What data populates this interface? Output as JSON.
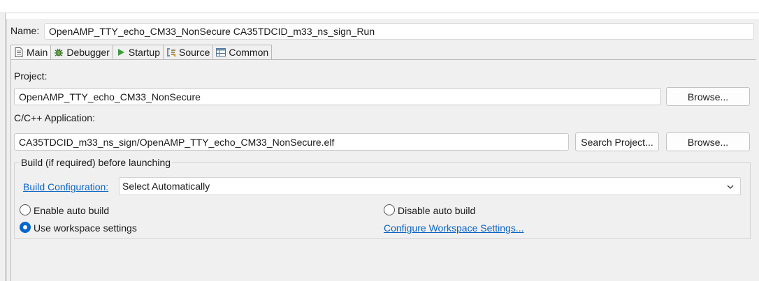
{
  "name_row": {
    "label": "Name:",
    "value": "OpenAMP_TTY_echo_CM33_NonSecure CA35TDCID_m33_ns_sign_Run"
  },
  "tabs": [
    {
      "label": "Main",
      "icon": "document-icon",
      "active": true
    },
    {
      "label": "Debugger",
      "icon": "bug-icon",
      "active": false
    },
    {
      "label": "Startup",
      "icon": "play-icon",
      "active": false
    },
    {
      "label": "Source",
      "icon": "source-lookup-icon",
      "active": false
    },
    {
      "label": "Common",
      "icon": "table-icon",
      "active": false
    }
  ],
  "project": {
    "label": "Project:",
    "value": "OpenAMP_TTY_echo_CM33_NonSecure",
    "browse_label": "Browse..."
  },
  "application": {
    "label": "C/C++ Application:",
    "value": "CA35TDCID_m33_ns_sign/OpenAMP_TTY_echo_CM33_NonSecure.elf",
    "search_label": "Search Project...",
    "browse_label": "Browse..."
  },
  "build": {
    "group_title": "Build (if required) before launching",
    "config_link": "Build Configuration:",
    "config_value": "Select Automatically",
    "options": {
      "enable_auto": {
        "label": "Enable auto build",
        "selected": false
      },
      "disable_auto": {
        "label": "Disable auto build",
        "selected": false
      },
      "use_workspace": {
        "label": "Use workspace settings",
        "selected": true
      }
    },
    "configure_link": "Configure Workspace Settings..."
  },
  "colors": {
    "panel_bg": "#f0f0f0",
    "link": "#0b63c2",
    "radio_selected": "#0066cc"
  }
}
